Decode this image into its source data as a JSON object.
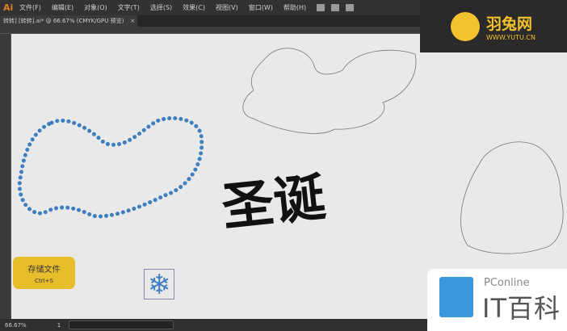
{
  "menubar": {
    "app_logo": "Ai",
    "items": [
      "文件(F)",
      "编辑(E)",
      "对象(O)",
      "文字(T)",
      "选择(S)",
      "效果(C)",
      "视图(V)",
      "窗口(W)",
      "帮助(H)"
    ]
  },
  "tab": {
    "title": "转转] [转转].ai* @ 66.67% (CMYK/GPU 预览)",
    "close": "×"
  },
  "brand": {
    "name": "羽兔网",
    "url": "WWW.YUTU.CN"
  },
  "save_hint": {
    "label": "存储文件",
    "shortcut": "Ctrl+S"
  },
  "artwork": {
    "lettering": "圣诞"
  },
  "status": {
    "zoom": "66.67%",
    "page": "1"
  },
  "watermark": {
    "top": "PConline",
    "bottom": "IT百科"
  },
  "colors": {
    "accent": "#e7bd2c",
    "snow": "#3f7fbf"
  }
}
